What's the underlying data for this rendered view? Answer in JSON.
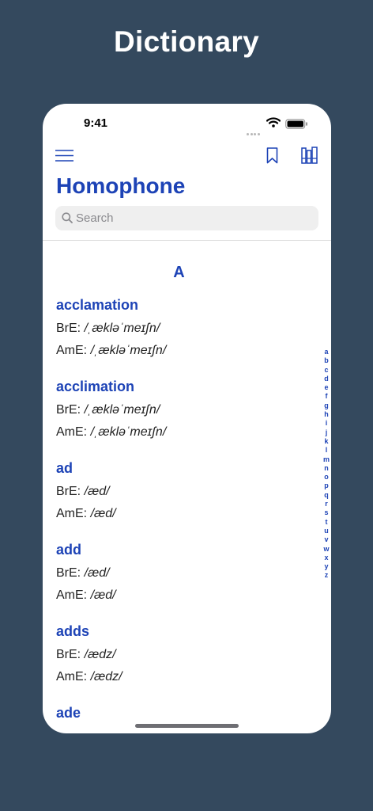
{
  "promo": {
    "title": "Dictionary"
  },
  "status_bar": {
    "time": "9:41"
  },
  "nav": {
    "menu_icon": "hamburger-menu-icon",
    "bookmark_icon": "bookmark-icon",
    "library_icon": "library-books-icon"
  },
  "page": {
    "title": "Homophone"
  },
  "search": {
    "placeholder": "Search",
    "value": ""
  },
  "section": {
    "letter": "A"
  },
  "entries": [
    {
      "word": "acclamation",
      "bre_label": "BrE:",
      "bre_ipa": "/ˌækləˈmeɪʃn/",
      "ame_label": "AmE:",
      "ame_ipa": "/ˌækləˈmeɪʃn/"
    },
    {
      "word": "acclimation",
      "bre_label": "BrE:",
      "bre_ipa": "/ˌækləˈmeɪʃn/",
      "ame_label": "AmE:",
      "ame_ipa": "/ˌækləˈmeɪʃn/"
    },
    {
      "word": "ad",
      "bre_label": "BrE:",
      "bre_ipa": "/æd/",
      "ame_label": "AmE:",
      "ame_ipa": "/æd/"
    },
    {
      "word": "add",
      "bre_label": "BrE:",
      "bre_ipa": "/æd/",
      "ame_label": "AmE:",
      "ame_ipa": "/æd/"
    },
    {
      "word": "adds",
      "bre_label": "BrE:",
      "bre_ipa": "/ædz/",
      "ame_label": "AmE:",
      "ame_ipa": "/ædz/"
    },
    {
      "word": "ade"
    }
  ],
  "index_letters": [
    "a",
    "b",
    "c",
    "d",
    "e",
    "f",
    "g",
    "h",
    "i",
    "j",
    "k",
    "l",
    "m",
    "n",
    "o",
    "p",
    "q",
    "r",
    "s",
    "t",
    "u",
    "v",
    "w",
    "x",
    "y",
    "z"
  ],
  "colors": {
    "background": "#34495e",
    "accent": "#1d43b6",
    "surface": "#ffffff"
  }
}
